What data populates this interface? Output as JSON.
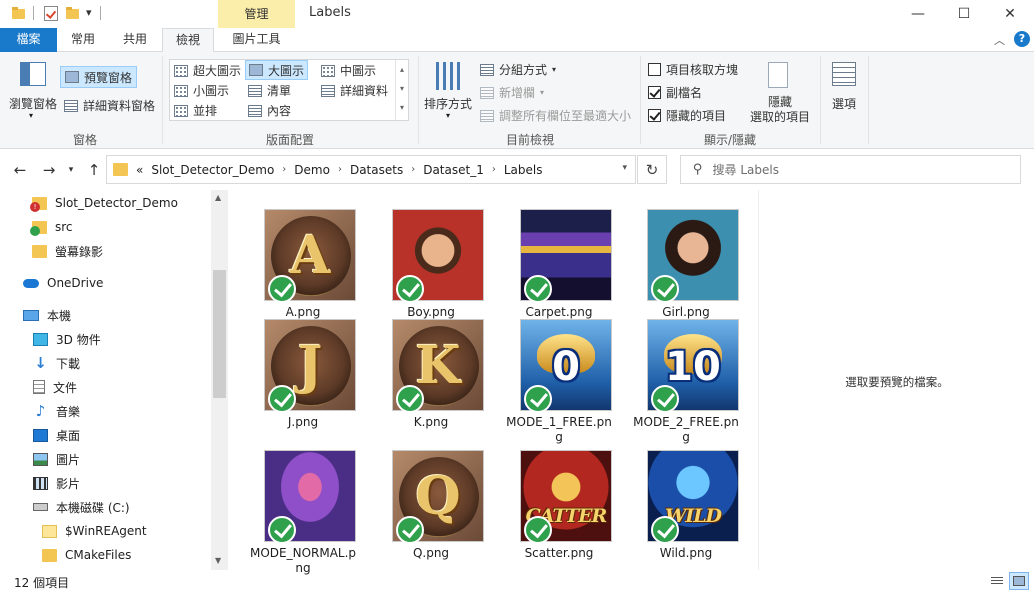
{
  "window": {
    "title": "Labels",
    "contextual_tab_group": "管理",
    "controls": {
      "minimize": "—",
      "maximize": "☐",
      "close": "✕"
    }
  },
  "ribbon_tabs": [
    {
      "label": "檔案",
      "selected": false
    },
    {
      "label": "常用",
      "selected": false
    },
    {
      "label": "共用",
      "selected": false
    },
    {
      "label": "檢視",
      "selected": true
    },
    {
      "label": "圖片工具",
      "selected": false
    }
  ],
  "ribbon": {
    "panes": {
      "group_label": "窗格",
      "nav_pane": "瀏覽窗格",
      "preview_pane": "預覽窗格",
      "details_pane": "詳細資料窗格"
    },
    "layout": {
      "group_label": "版面配置",
      "items": [
        {
          "label": "超大圖示",
          "selected": false
        },
        {
          "label": "大圖示",
          "selected": true
        },
        {
          "label": "中圖示",
          "selected": false
        },
        {
          "label": "小圖示",
          "selected": false
        },
        {
          "label": "清單",
          "selected": false
        },
        {
          "label": "詳細資料",
          "selected": false
        },
        {
          "label": "並排",
          "selected": false
        },
        {
          "label": "內容",
          "selected": false
        }
      ]
    },
    "current_view": {
      "group_label": "目前檢視",
      "sort": "排序方式",
      "group_by": "分組方式",
      "add_columns": "新增欄",
      "size_all_columns": "調整所有欄位至最適大小"
    },
    "show_hide": {
      "group_label": "顯示/隱藏",
      "item_check_boxes": {
        "label": "項目核取方塊",
        "checked": false
      },
      "file_name_extensions": {
        "label": "副檔名",
        "checked": true
      },
      "hidden_items": {
        "label": "隱藏的項目",
        "checked": true
      },
      "hide_selected_line1": "隱藏",
      "hide_selected_line2": "選取的項目"
    },
    "options": "選項"
  },
  "address": {
    "overflow": "«",
    "crumbs": [
      "Slot_Detector_Demo",
      "Demo",
      "Datasets",
      "Dataset_1",
      "Labels"
    ],
    "search_placeholder": "搜尋 Labels"
  },
  "nav": {
    "items": [
      {
        "label": "Slot_Detector_Demo",
        "icon": "folder-error-icon"
      },
      {
        "label": "src",
        "icon": "folder-synced-icon"
      },
      {
        "label": "螢幕錄影",
        "icon": "folder-icon"
      },
      {
        "label": "OneDrive",
        "icon": "cloud-icon"
      },
      {
        "label": "本機",
        "icon": "computer-icon"
      },
      {
        "label": "3D 物件",
        "icon": "cube-icon"
      },
      {
        "label": "下載",
        "icon": "download-icon"
      },
      {
        "label": "文件",
        "icon": "document-icon"
      },
      {
        "label": "音樂",
        "icon": "music-icon"
      },
      {
        "label": "桌面",
        "icon": "desktop-icon"
      },
      {
        "label": "圖片",
        "icon": "pictures-icon"
      },
      {
        "label": "影片",
        "icon": "video-icon"
      },
      {
        "label": "本機磁碟 (C:)",
        "icon": "drive-icon"
      },
      {
        "label": "$WinREAgent",
        "icon": "folder-icon"
      },
      {
        "label": "CMakeFiles",
        "icon": "folder-icon"
      }
    ]
  },
  "files": [
    {
      "name": "A.png",
      "art": "coin",
      "letter": "A"
    },
    {
      "name": "Boy.png",
      "art": "boy"
    },
    {
      "name": "Carpet.png",
      "art": "carpet"
    },
    {
      "name": "Girl.png",
      "art": "girl"
    },
    {
      "name": "J.png",
      "art": "coin",
      "letter": "J"
    },
    {
      "name": "K.png",
      "art": "coin",
      "letter": "K"
    },
    {
      "name": "MODE_1_FREE.png",
      "art": "lamp",
      "number": "0"
    },
    {
      "name": "MODE_2_FREE.png",
      "art": "lamp",
      "number": "10"
    },
    {
      "name": "MODE_NORMAL.png",
      "art": "palace"
    },
    {
      "name": "Q.png",
      "art": "coin",
      "letter": "Q"
    },
    {
      "name": "Scatter.png",
      "art": "scatter",
      "text": "CATTER"
    },
    {
      "name": "Wild.png",
      "art": "wild",
      "text": "WILD"
    }
  ],
  "preview": {
    "message": "選取要預覽的檔案。"
  },
  "status": {
    "count": "12 個項目"
  },
  "colors": {
    "accent": "#1979ca",
    "selected": "#cce8ff",
    "sync_green": "#2fa04c",
    "folder": "#f3c552"
  }
}
